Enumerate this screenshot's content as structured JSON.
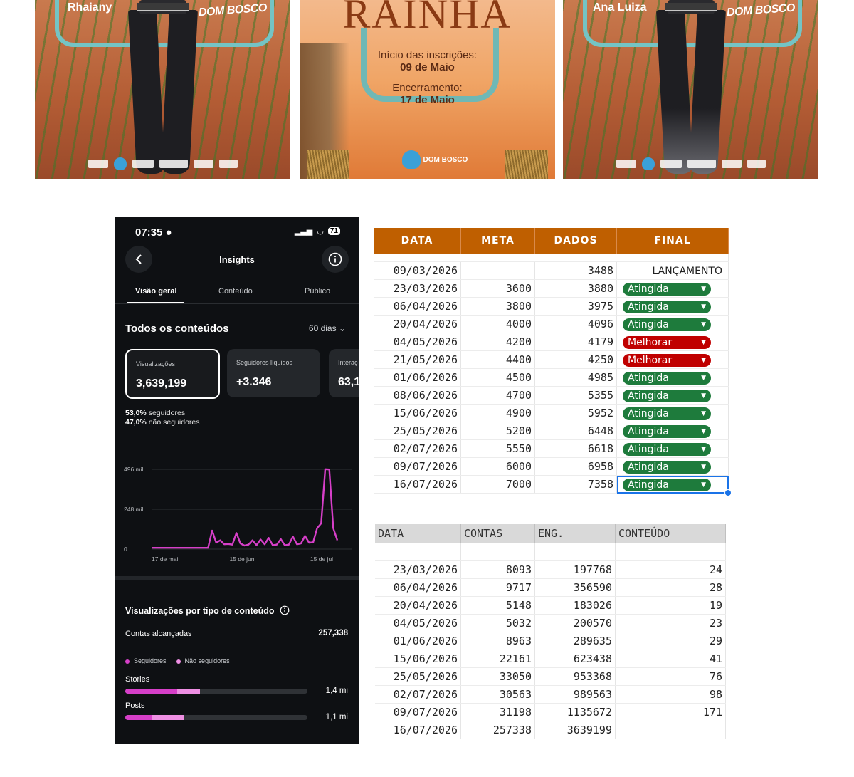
{
  "posters": {
    "left": {
      "name": "Rhaiany",
      "brand": "DOM BOSCO"
    },
    "center": {
      "title": "RAINHA",
      "start_label": "Início das inscrições:",
      "start_date": "09 de Maio",
      "end_label": "Encerramento:",
      "end_date": "17 de Maio",
      "logo_text": "DOM BOSCO"
    },
    "right": {
      "name": "Ana Luiza",
      "brand": "DOM BOSCO"
    }
  },
  "phone": {
    "status_time": "07:35",
    "battery": "71",
    "title": "Insights",
    "tabs": [
      "Visão geral",
      "Conteúdo",
      "Público"
    ],
    "section_title": "Todos os conteúdos",
    "period": "60 dias",
    "cards": [
      {
        "label": "Visualizações",
        "value": "3,639,199"
      },
      {
        "label": "Seguidores líquidos",
        "value": "+3.346"
      },
      {
        "label": "Interaç",
        "value": "63,1"
      }
    ],
    "followers_pct": "53,0%",
    "followers_label": "seguidores",
    "non_followers_pct": "47,0%",
    "non_followers_label": "não seguidores",
    "views_by_type_title": "Visualizações por tipo de conteúdo",
    "accounts_reached_label": "Contas alcançadas",
    "accounts_reached_value": "257,338",
    "legend_followers": "Seguidores",
    "legend_non_followers": "Não seguidores",
    "rows": [
      {
        "label": "Stories",
        "value": "1,4 mi",
        "followers_frac": 0.286,
        "non_followers_frac": 0.125
      },
      {
        "label": "Posts",
        "value": "1,1 mi",
        "followers_frac": 0.145,
        "non_followers_frac": 0.18
      }
    ],
    "colors": {
      "accent": "#d63fc8",
      "accent_light": "#ee8fe3"
    }
  },
  "chart_data": {
    "type": "line",
    "y_ticks": [
      "496 mil",
      "248 mil",
      "0"
    ],
    "x_ticks": [
      "17 de mai",
      "15 de jun",
      "15 de jul"
    ],
    "ylim": [
      0,
      496000
    ],
    "values": [
      8,
      8,
      8,
      8,
      8,
      8,
      8,
      8,
      8,
      8,
      8,
      8,
      8,
      8,
      8,
      115,
      40,
      55,
      30,
      32,
      28,
      100,
      35,
      22,
      28,
      55,
      25,
      60,
      30,
      70,
      25,
      28,
      62,
      24,
      28,
      78,
      30,
      35,
      82,
      40,
      42,
      130,
      160,
      497,
      495,
      130,
      55
    ]
  },
  "sheet1": {
    "headers": [
      "DATA",
      "META",
      "DADOS",
      "FINAL"
    ],
    "rows": [
      {
        "data": "09/03/2026",
        "meta": "",
        "dados": "3488",
        "final": "LANÇAMENTO"
      },
      {
        "data": "23/03/2026",
        "meta": "3600",
        "dados": "3880",
        "final": "Atingida"
      },
      {
        "data": "06/04/2026",
        "meta": "3800",
        "dados": "3975",
        "final": "Atingida"
      },
      {
        "data": "20/04/2026",
        "meta": "4000",
        "dados": "4096",
        "final": "Atingida"
      },
      {
        "data": "04/05/2026",
        "meta": "4200",
        "dados": "4179",
        "final": "Melhorar"
      },
      {
        "data": "21/05/2026",
        "meta": "4400",
        "dados": "4250",
        "final": "Melhorar"
      },
      {
        "data": "01/06/2026",
        "meta": "4500",
        "dados": "4985",
        "final": "Atingida"
      },
      {
        "data": "08/06/2026",
        "meta": "4700",
        "dados": "5355",
        "final": "Atingida"
      },
      {
        "data": "15/06/2026",
        "meta": "4900",
        "dados": "5952",
        "final": "Atingida"
      },
      {
        "data": "25/05/2026",
        "meta": "5200",
        "dados": "6448",
        "final": "Atingida"
      },
      {
        "data": "02/07/2026",
        "meta": "5550",
        "dados": "6618",
        "final": "Atingida"
      },
      {
        "data": "09/07/2026",
        "meta": "6000",
        "dados": "6958",
        "final": "Atingida"
      },
      {
        "data": "16/07/2026",
        "meta": "7000",
        "dados": "7358",
        "final": "Atingida"
      }
    ],
    "colors": {
      "header": "#bf5f00",
      "atingida": "#1e7b3c",
      "melhorar": "#c00000"
    }
  },
  "sheet2": {
    "headers": [
      "DATA",
      "CONTAS",
      "ENG.",
      "CONTEÚDO"
    ],
    "rows": [
      {
        "data": "23/03/2026",
        "contas": "8093",
        "eng": "197768",
        "conteudo": "24"
      },
      {
        "data": "06/04/2026",
        "contas": "9717",
        "eng": "356590",
        "conteudo": "28"
      },
      {
        "data": "20/04/2026",
        "contas": "5148",
        "eng": "183026",
        "conteudo": "19"
      },
      {
        "data": "04/05/2026",
        "contas": "5032",
        "eng": "200570",
        "conteudo": "23"
      },
      {
        "data": "01/06/2026",
        "contas": "8963",
        "eng": "289635",
        "conteudo": "29"
      },
      {
        "data": "15/06/2026",
        "contas": "22161",
        "eng": "623438",
        "conteudo": "41"
      },
      {
        "data": "25/05/2026",
        "contas": "33050",
        "eng": "953368",
        "conteudo": "76"
      },
      {
        "data": "02/07/2026",
        "contas": "30563",
        "eng": "989563",
        "conteudo": "98"
      },
      {
        "data": "09/07/2026",
        "contas": "31198",
        "eng": "1135672",
        "conteudo": "171"
      },
      {
        "data": "16/07/2026",
        "contas": "257338",
        "eng": "3639199",
        "conteudo": ""
      }
    ]
  }
}
